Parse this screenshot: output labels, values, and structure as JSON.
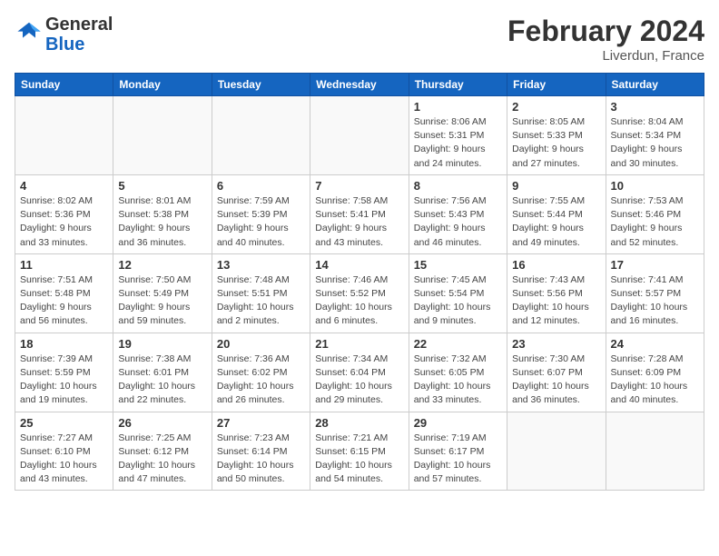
{
  "header": {
    "logo_general": "General",
    "logo_blue": "Blue",
    "month_year": "February 2024",
    "location": "Liverdun, France"
  },
  "weekdays": [
    "Sunday",
    "Monday",
    "Tuesday",
    "Wednesday",
    "Thursday",
    "Friday",
    "Saturday"
  ],
  "weeks": [
    [
      {
        "day": "",
        "info": ""
      },
      {
        "day": "",
        "info": ""
      },
      {
        "day": "",
        "info": ""
      },
      {
        "day": "",
        "info": ""
      },
      {
        "day": "1",
        "info": "Sunrise: 8:06 AM\nSunset: 5:31 PM\nDaylight: 9 hours\nand 24 minutes."
      },
      {
        "day": "2",
        "info": "Sunrise: 8:05 AM\nSunset: 5:33 PM\nDaylight: 9 hours\nand 27 minutes."
      },
      {
        "day": "3",
        "info": "Sunrise: 8:04 AM\nSunset: 5:34 PM\nDaylight: 9 hours\nand 30 minutes."
      }
    ],
    [
      {
        "day": "4",
        "info": "Sunrise: 8:02 AM\nSunset: 5:36 PM\nDaylight: 9 hours\nand 33 minutes."
      },
      {
        "day": "5",
        "info": "Sunrise: 8:01 AM\nSunset: 5:38 PM\nDaylight: 9 hours\nand 36 minutes."
      },
      {
        "day": "6",
        "info": "Sunrise: 7:59 AM\nSunset: 5:39 PM\nDaylight: 9 hours\nand 40 minutes."
      },
      {
        "day": "7",
        "info": "Sunrise: 7:58 AM\nSunset: 5:41 PM\nDaylight: 9 hours\nand 43 minutes."
      },
      {
        "day": "8",
        "info": "Sunrise: 7:56 AM\nSunset: 5:43 PM\nDaylight: 9 hours\nand 46 minutes."
      },
      {
        "day": "9",
        "info": "Sunrise: 7:55 AM\nSunset: 5:44 PM\nDaylight: 9 hours\nand 49 minutes."
      },
      {
        "day": "10",
        "info": "Sunrise: 7:53 AM\nSunset: 5:46 PM\nDaylight: 9 hours\nand 52 minutes."
      }
    ],
    [
      {
        "day": "11",
        "info": "Sunrise: 7:51 AM\nSunset: 5:48 PM\nDaylight: 9 hours\nand 56 minutes."
      },
      {
        "day": "12",
        "info": "Sunrise: 7:50 AM\nSunset: 5:49 PM\nDaylight: 9 hours\nand 59 minutes."
      },
      {
        "day": "13",
        "info": "Sunrise: 7:48 AM\nSunset: 5:51 PM\nDaylight: 10 hours\nand 2 minutes."
      },
      {
        "day": "14",
        "info": "Sunrise: 7:46 AM\nSunset: 5:52 PM\nDaylight: 10 hours\nand 6 minutes."
      },
      {
        "day": "15",
        "info": "Sunrise: 7:45 AM\nSunset: 5:54 PM\nDaylight: 10 hours\nand 9 minutes."
      },
      {
        "day": "16",
        "info": "Sunrise: 7:43 AM\nSunset: 5:56 PM\nDaylight: 10 hours\nand 12 minutes."
      },
      {
        "day": "17",
        "info": "Sunrise: 7:41 AM\nSunset: 5:57 PM\nDaylight: 10 hours\nand 16 minutes."
      }
    ],
    [
      {
        "day": "18",
        "info": "Sunrise: 7:39 AM\nSunset: 5:59 PM\nDaylight: 10 hours\nand 19 minutes."
      },
      {
        "day": "19",
        "info": "Sunrise: 7:38 AM\nSunset: 6:01 PM\nDaylight: 10 hours\nand 22 minutes."
      },
      {
        "day": "20",
        "info": "Sunrise: 7:36 AM\nSunset: 6:02 PM\nDaylight: 10 hours\nand 26 minutes."
      },
      {
        "day": "21",
        "info": "Sunrise: 7:34 AM\nSunset: 6:04 PM\nDaylight: 10 hours\nand 29 minutes."
      },
      {
        "day": "22",
        "info": "Sunrise: 7:32 AM\nSunset: 6:05 PM\nDaylight: 10 hours\nand 33 minutes."
      },
      {
        "day": "23",
        "info": "Sunrise: 7:30 AM\nSunset: 6:07 PM\nDaylight: 10 hours\nand 36 minutes."
      },
      {
        "day": "24",
        "info": "Sunrise: 7:28 AM\nSunset: 6:09 PM\nDaylight: 10 hours\nand 40 minutes."
      }
    ],
    [
      {
        "day": "25",
        "info": "Sunrise: 7:27 AM\nSunset: 6:10 PM\nDaylight: 10 hours\nand 43 minutes."
      },
      {
        "day": "26",
        "info": "Sunrise: 7:25 AM\nSunset: 6:12 PM\nDaylight: 10 hours\nand 47 minutes."
      },
      {
        "day": "27",
        "info": "Sunrise: 7:23 AM\nSunset: 6:14 PM\nDaylight: 10 hours\nand 50 minutes."
      },
      {
        "day": "28",
        "info": "Sunrise: 7:21 AM\nSunset: 6:15 PM\nDaylight: 10 hours\nand 54 minutes."
      },
      {
        "day": "29",
        "info": "Sunrise: 7:19 AM\nSunset: 6:17 PM\nDaylight: 10 hours\nand 57 minutes."
      },
      {
        "day": "",
        "info": ""
      },
      {
        "day": "",
        "info": ""
      }
    ]
  ]
}
